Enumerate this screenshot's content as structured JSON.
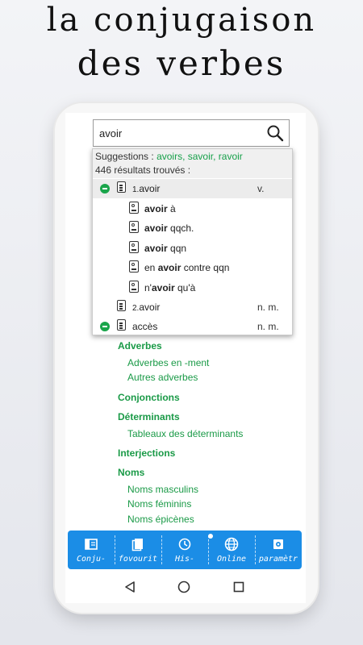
{
  "header": {
    "line1": "la conjugaison",
    "line2": "des verbes"
  },
  "search": {
    "value": "avoir"
  },
  "dropdown": {
    "suggestions_label": "Suggestions :",
    "suggestions": [
      "avoirs,",
      "savoir,",
      "ravoir"
    ],
    "results_count": "446 résultats trouvés  :",
    "rows": [
      {
        "num": "1.",
        "word": "avoir",
        "tag": "v."
      },
      {
        "bold": "avoir",
        "rest": " à"
      },
      {
        "bold": "avoir",
        "rest": " qqch."
      },
      {
        "bold": "avoir",
        "rest": " qqn"
      },
      {
        "pre": "en ",
        "bold": "avoir",
        "rest": " contre qqn"
      },
      {
        "pre": "n'",
        "bold": "avoir",
        "rest": " qu'à"
      },
      {
        "num": "2.",
        "word": "avoir",
        "tag": "n. m."
      },
      {
        "word": "accès",
        "tag": "n. m."
      }
    ]
  },
  "categories": {
    "adverbes": "Adverbes",
    "adverbes_items": [
      "Adverbes en -ment",
      "Autres adverbes"
    ],
    "conjonctions": "Conjonctions",
    "determinants": "Déterminants",
    "determinants_items": [
      "Tableaux des déterminants"
    ],
    "interjections": "Interjections",
    "noms": "Noms",
    "noms_items": [
      "Noms masculins",
      "Noms féminins",
      "Noms épicènes"
    ]
  },
  "nav": {
    "items": [
      "Conju-",
      "fovourit",
      "His-",
      "Online",
      "paramètr"
    ]
  },
  "colors": {
    "accent_green": "#1a9a47",
    "nav_blue": "#1b8de6"
  }
}
